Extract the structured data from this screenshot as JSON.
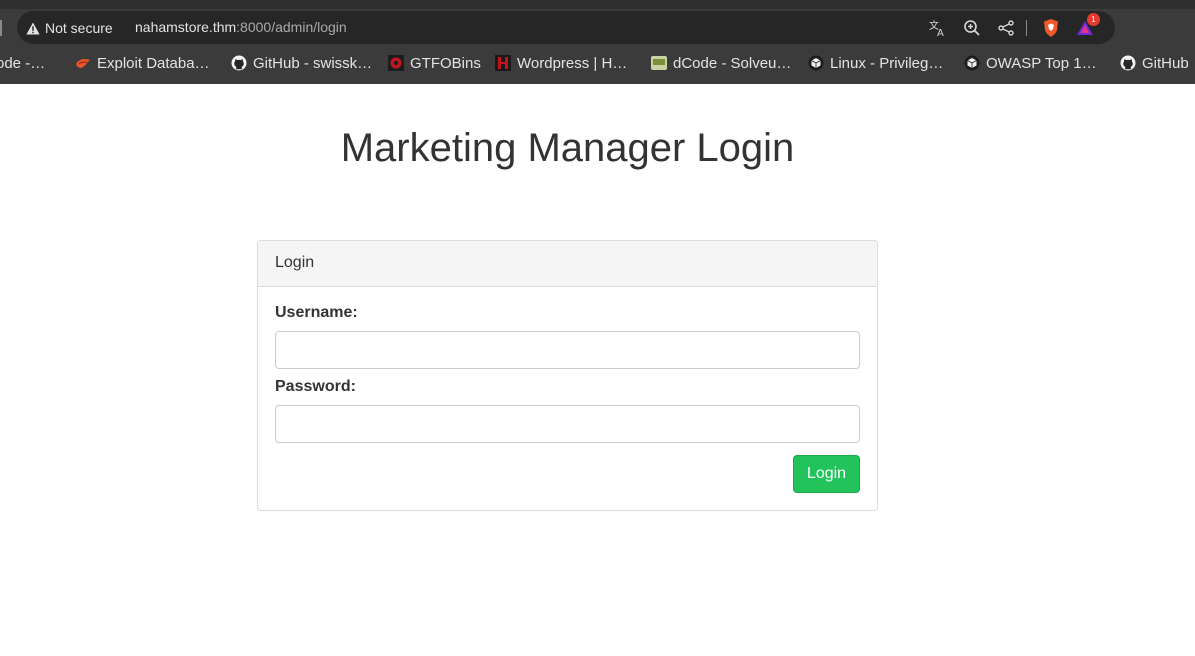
{
  "browser": {
    "security_label": "Not secure",
    "url_host": "nahamstore.thm",
    "url_rest": ":8000/admin/login",
    "rewards_count": "1",
    "icons": [
      "translate-icon",
      "zoom-icon",
      "share-icon",
      "brave-shields-icon",
      "brave-rewards-icon"
    ],
    "bookmarks": [
      {
        "label": "ode -…",
        "icon": "generic-favicon"
      },
      {
        "label": "Exploit Databa…",
        "icon": "exploit-db-icon"
      },
      {
        "label": "GitHub - swissk…",
        "icon": "github-icon"
      },
      {
        "label": "GTFOBins",
        "icon": "gtfobins-icon"
      },
      {
        "label": "Wordpress | H…",
        "icon": "hacktricks-icon"
      },
      {
        "label": "dCode - Solveu…",
        "icon": "dcode-icon"
      },
      {
        "label": "Linux - Privileg…",
        "icon": "hacktricks-cube-icon"
      },
      {
        "label": "OWASP Top 1…",
        "icon": "hacktricks-cube-icon"
      },
      {
        "label": "GitHub",
        "icon": "github-icon"
      }
    ]
  },
  "page": {
    "title": "Marketing Manager Login",
    "panel_heading": "Login",
    "username_label": "Username:",
    "username_value": "",
    "password_label": "Password:",
    "password_value": "",
    "login_button": "Login"
  },
  "colors": {
    "chrome_bg": "#3b3b3b",
    "address_bar_bg": "#262626",
    "login_button_bg": "#22c35a",
    "panel_heading_bg": "#f5f5f5"
  }
}
